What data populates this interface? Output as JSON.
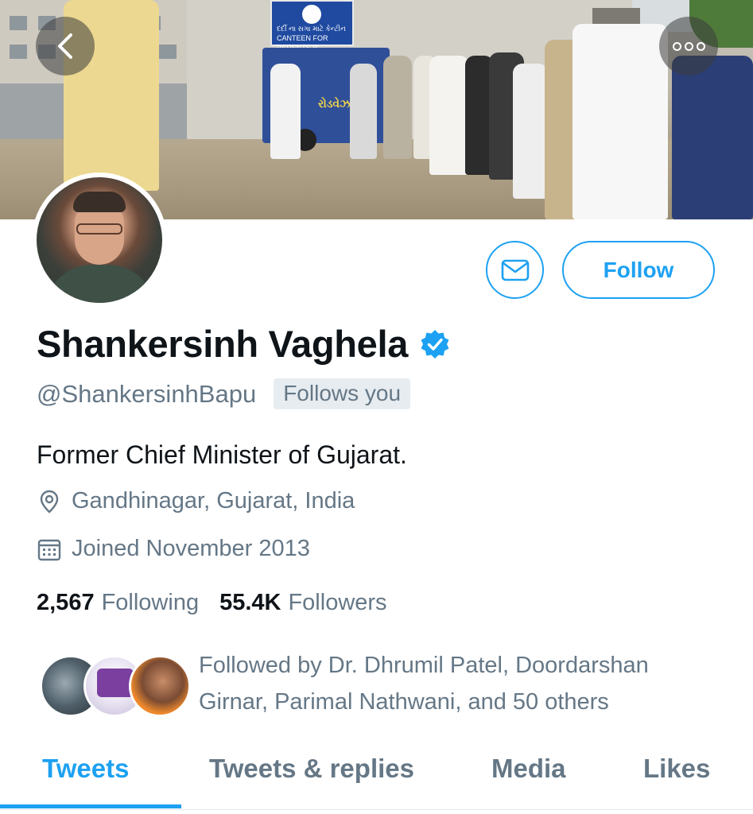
{
  "banner": {
    "sign_text": "દર્દી ના સગા માટે કેન્ટીન CANTEEN FOR PATIENTS R",
    "cart_text": "રોડવેઝ"
  },
  "header": {
    "back_icon": "chevron-left-icon",
    "more_icon": "more-horizontal-icon"
  },
  "actions": {
    "message_icon": "envelope-icon",
    "follow_label": "Follow"
  },
  "profile": {
    "name": "Shankersinh Vaghela",
    "verified_icon": "verified-badge-icon",
    "handle": "@ShankersinhBapu",
    "follows_you": "Follows you",
    "bio": "Former Chief Minister of Gujarat.",
    "location": "Gandhinagar, Gujarat, India",
    "joined": "Joined November 2013",
    "following_count": "2,567",
    "following_label": "Following",
    "followers_count": "55.4K",
    "followers_label": "Followers"
  },
  "followed_by": {
    "text": "Followed by Dr. Dhrumil Patel, Doordarshan Girnar, Parimal Nathwani, and 50 others"
  },
  "tabs": [
    {
      "label": "Tweets",
      "active": true
    },
    {
      "label": "Tweets & replies",
      "active": false
    },
    {
      "label": "Media",
      "active": false
    },
    {
      "label": "Likes",
      "active": false
    }
  ],
  "colors": {
    "accent": "#1da1f2",
    "secondary_text": "#657786",
    "primary_text": "#0f1419"
  }
}
